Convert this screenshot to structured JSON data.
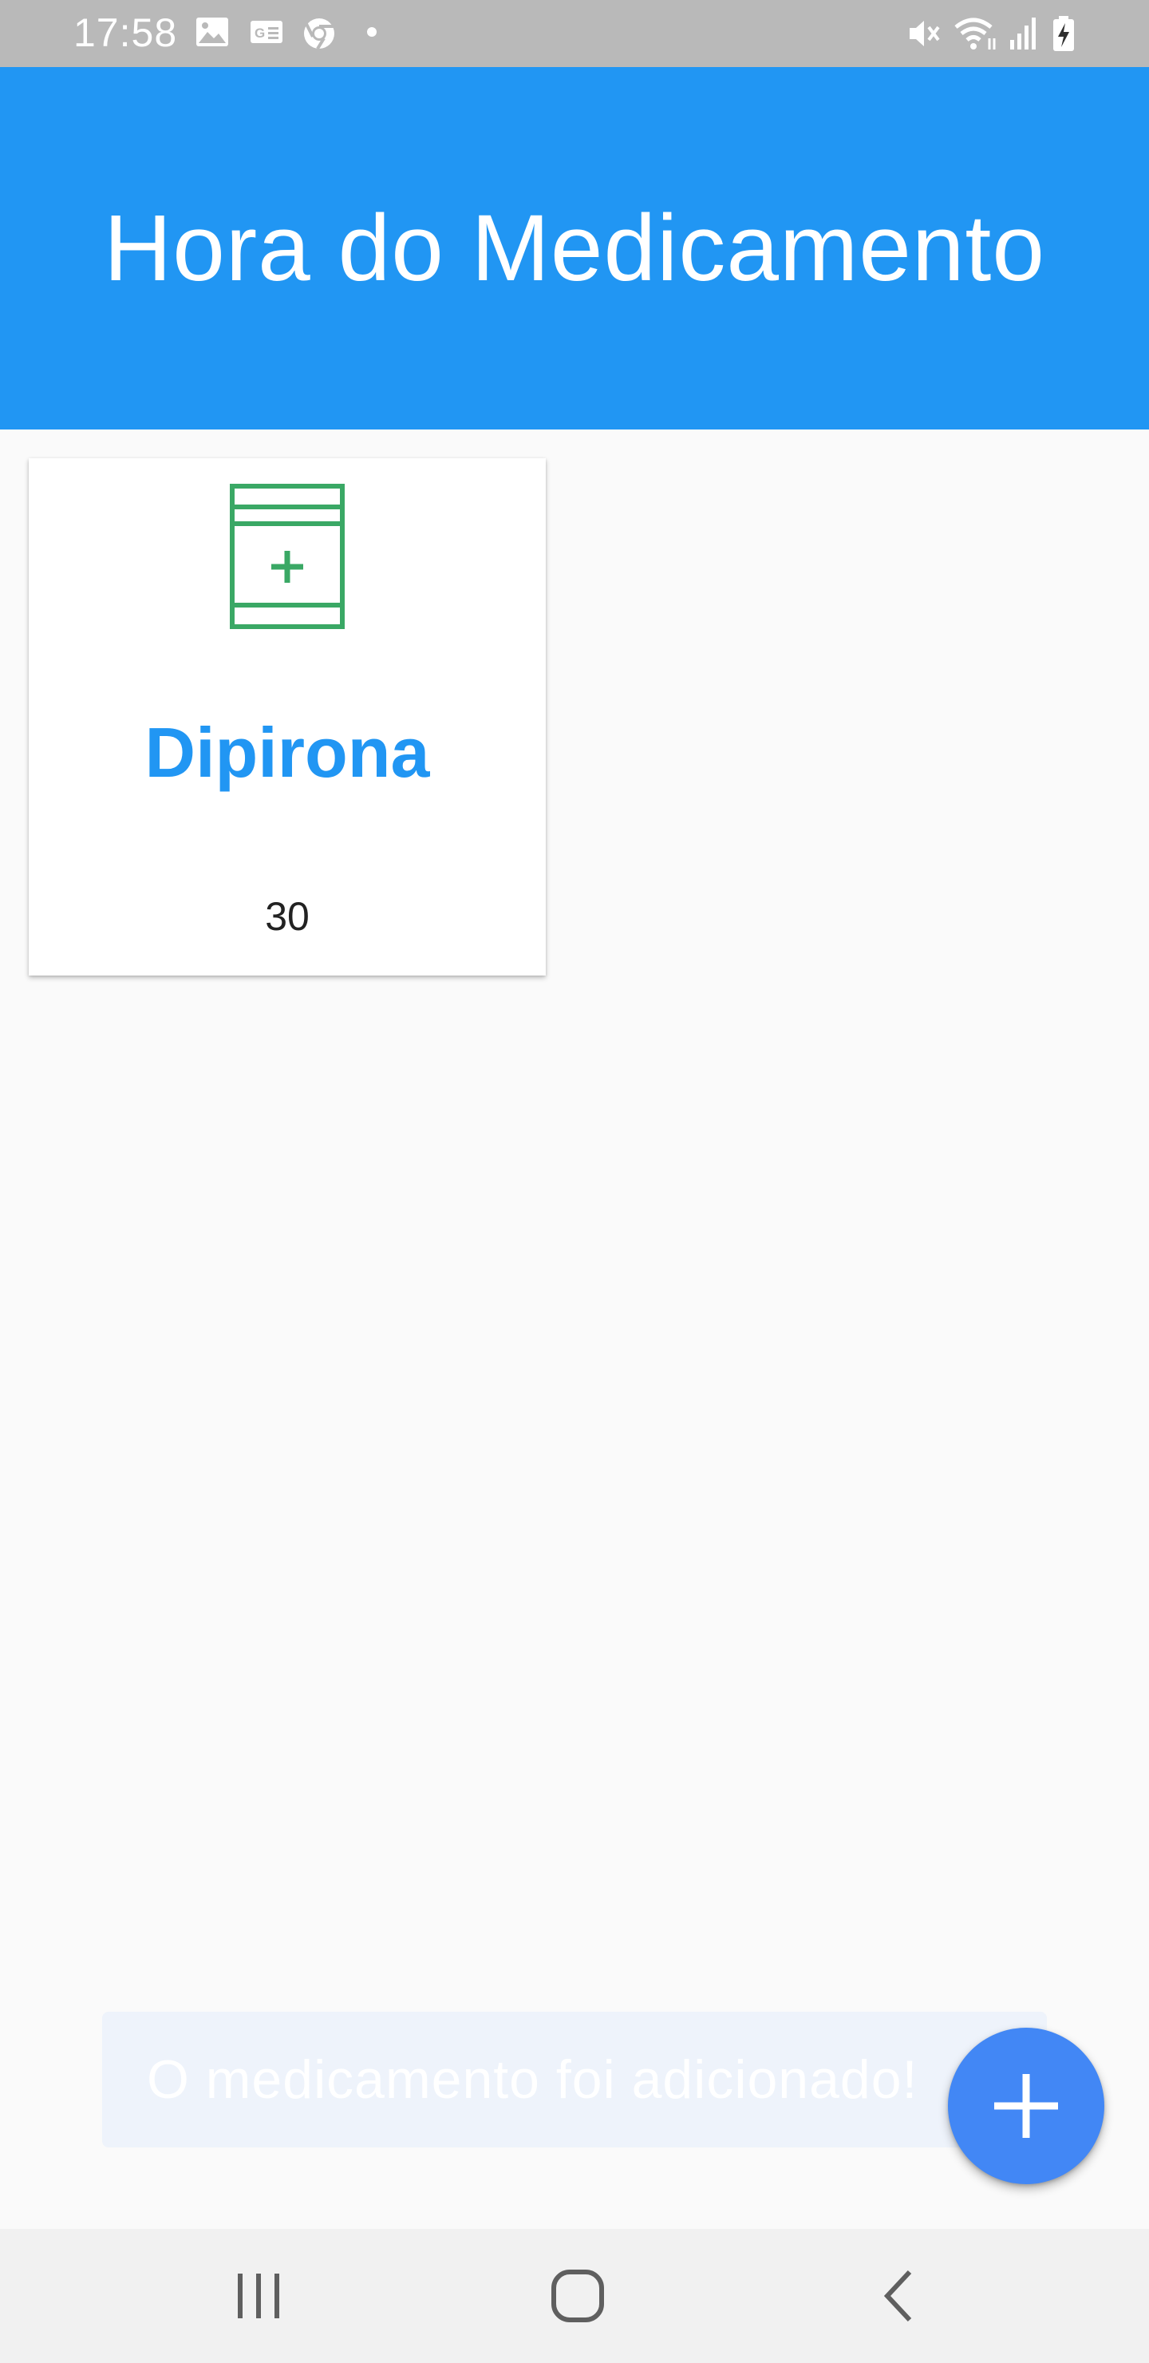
{
  "status_bar": {
    "time": "17:58",
    "left_icons": [
      "image-icon",
      "news-icon",
      "chrome-icon",
      "dot-icon"
    ],
    "right_icons": [
      "mute-icon",
      "wifi-icon",
      "signal-icon",
      "battery-charging-icon"
    ]
  },
  "app_bar": {
    "title": "Hora do Medicamento",
    "color": "#2196f3"
  },
  "medications": [
    {
      "name": "Dipirona",
      "quantity": "30",
      "icon": "medicine-bottle-icon",
      "icon_color": "#3aa865"
    }
  ],
  "snackbar": {
    "message": "O medicamento foi adicionado!"
  },
  "fab": {
    "icon": "add-icon",
    "color": "#4287f5"
  },
  "nav_bar": {
    "buttons": [
      "recent-apps-icon",
      "home-icon",
      "back-icon"
    ]
  }
}
